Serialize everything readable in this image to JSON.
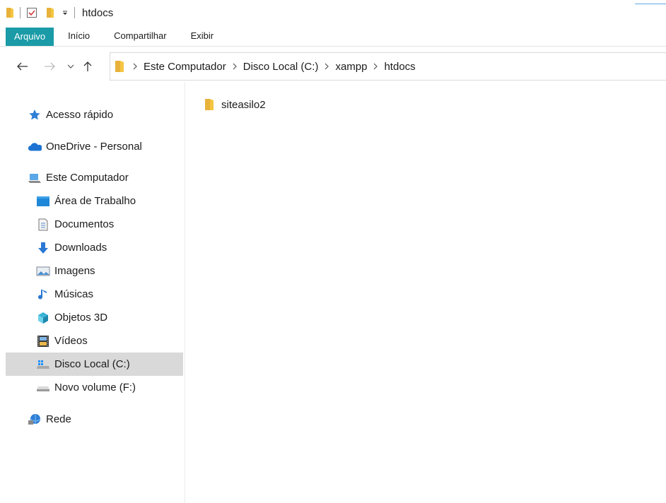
{
  "window": {
    "title": "htdocs"
  },
  "ribbon": {
    "tabs": [
      "Arquivo",
      "Início",
      "Compartilhar",
      "Exibir"
    ]
  },
  "address": {
    "crumbs": [
      "Este Computador",
      "Disco Local (C:)",
      "xampp",
      "htdocs"
    ]
  },
  "sidebar": {
    "quick_access": "Acesso rápido",
    "onedrive": "OneDrive - Personal",
    "this_pc": "Este Computador",
    "items": [
      {
        "label": "Área de Trabalho",
        "icon": "desktop-icon"
      },
      {
        "label": "Documentos",
        "icon": "documents-icon"
      },
      {
        "label": "Downloads",
        "icon": "downloads-icon"
      },
      {
        "label": "Imagens",
        "icon": "pictures-icon"
      },
      {
        "label": "Músicas",
        "icon": "music-icon"
      },
      {
        "label": "Objetos 3D",
        "icon": "objects-3d-icon"
      },
      {
        "label": "Vídeos",
        "icon": "videos-icon"
      },
      {
        "label": "Disco Local (C:)",
        "icon": "drive-c-icon",
        "selected": true
      },
      {
        "label": "Novo volume (F:)",
        "icon": "drive-f-icon"
      }
    ],
    "network": "Rede"
  },
  "content": {
    "files": [
      {
        "name": "siteasilo2",
        "icon": "folder-icon"
      }
    ]
  },
  "colors": {
    "file_tab": "#1a9ba7",
    "selected": "#d9d9d9",
    "folder": "#f5c542"
  }
}
